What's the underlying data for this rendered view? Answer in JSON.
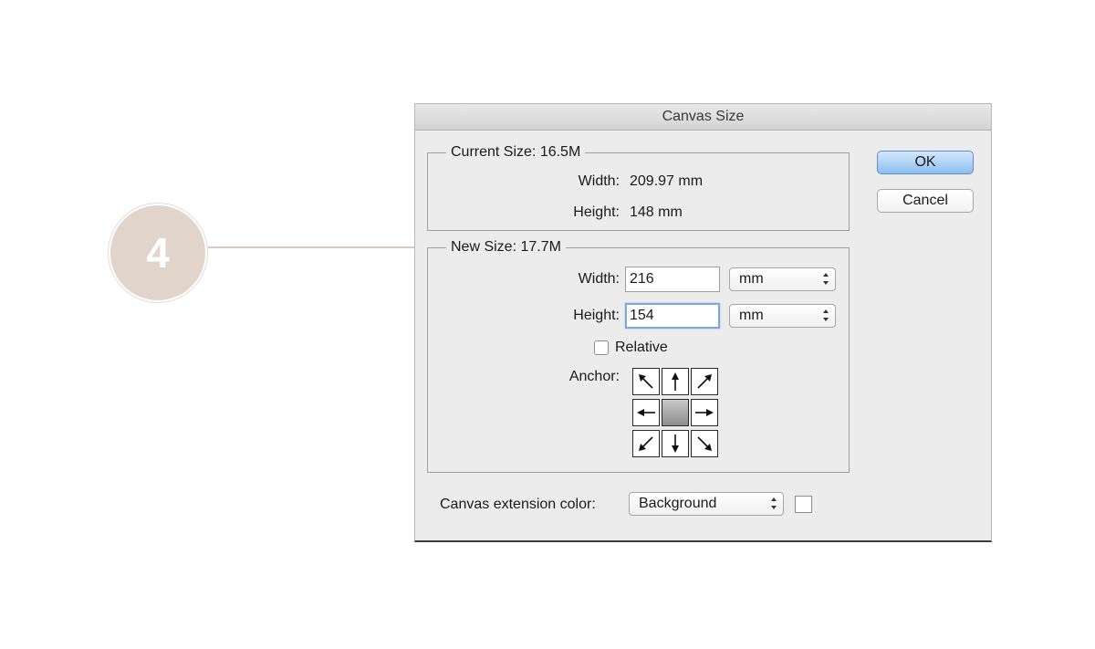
{
  "step": {
    "number": "4"
  },
  "dialog": {
    "title": "Canvas Size",
    "current_size": {
      "legend": "Current Size: 16.5M",
      "width_label": "Width:",
      "width_value": "209.97 mm",
      "height_label": "Height:",
      "height_value": "148 mm"
    },
    "new_size": {
      "legend": "New Size: 17.7M",
      "width_label": "Width:",
      "width_value": "216",
      "width_unit": "mm",
      "height_label": "Height:",
      "height_value": "154",
      "height_unit": "mm",
      "relative_label": "Relative",
      "relative_checked": false,
      "anchor_label": "Anchor:",
      "anchor_selected": "center"
    },
    "extension_color": {
      "label": "Canvas extension color:",
      "value": "Background",
      "swatch_color": "#ffffff"
    },
    "buttons": {
      "ok": "OK",
      "cancel": "Cancel"
    }
  },
  "icons": {
    "anchor_arrows": [
      "arrow-up-left-icon",
      "arrow-up-icon",
      "arrow-up-right-icon",
      "arrow-left-icon",
      "anchor-center",
      "arrow-right-icon",
      "arrow-down-left-icon",
      "arrow-down-icon",
      "arrow-down-right-icon"
    ]
  },
  "colors": {
    "step_badge": "#e1d4ca",
    "default_button": "#8cbef2",
    "focus_ring": "#7fa7d8"
  }
}
